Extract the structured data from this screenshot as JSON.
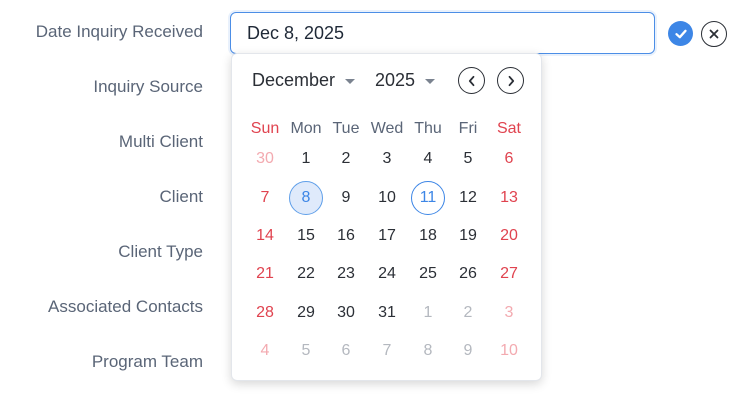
{
  "form": {
    "labels": [
      "Date Inquiry Received",
      "Inquiry Source",
      "Multi Client",
      "Client",
      "Client Type",
      "Associated Contacts",
      "Program Team"
    ],
    "date_value": "Dec 8, 2025"
  },
  "icons": {
    "confirm": "check-circle-icon",
    "cancel": "close-circle-icon",
    "prev": "chevron-left-icon",
    "next": "chevron-right-icon",
    "dropdown": "caret-down-icon"
  },
  "calendar": {
    "month": "December",
    "year": "2025",
    "weekdays": [
      "Sun",
      "Mon",
      "Tue",
      "Wed",
      "Thu",
      "Fri",
      "Sat"
    ],
    "selected_day": "8",
    "today_day": "11",
    "weeks": [
      [
        "30",
        "1",
        "2",
        "3",
        "4",
        "5",
        "6"
      ],
      [
        "7",
        "8",
        "9",
        "10",
        "11",
        "12",
        "13"
      ],
      [
        "14",
        "15",
        "16",
        "17",
        "18",
        "19",
        "20"
      ],
      [
        "21",
        "22",
        "23",
        "24",
        "25",
        "26",
        "27"
      ],
      [
        "28",
        "29",
        "30",
        "31",
        "1",
        "2",
        "3"
      ],
      [
        "4",
        "5",
        "6",
        "7",
        "8",
        "9",
        "10"
      ]
    ]
  },
  "colors": {
    "accent": "#3d86e6",
    "weekend": "#e0434f",
    "muted": "#b4b8bf",
    "label": "#5a6577"
  }
}
